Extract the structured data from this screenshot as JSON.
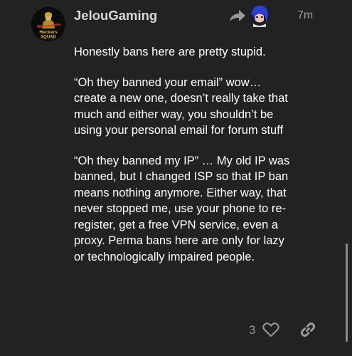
{
  "post": {
    "username": "JelouGaming",
    "date": "7m",
    "avatar_text": [
      "Heckers",
      "SQUAD"
    ],
    "paragraphs": [
      {
        "lines": [
          "Honestly bans here are pretty stupid."
        ]
      },
      {
        "lines": [
          "“Oh they banned your email” wow…",
          "create a new one, doesn’t really take that",
          "much and either way, you shouldn’t be",
          "using your personal email for forum stuff"
        ]
      },
      {
        "lines": [
          "“Oh they banned my IP” … My old IP was",
          "banned, but I changed ISP so that IP ban",
          "means nothing anymore. Either way, that",
          "never stopped me, use your phone to re-",
          "register, get a free VPN service, even a",
          "proxy. Perma bans here are only for lazy",
          "or technologically impaired people."
        ]
      }
    ],
    "like_count": "3"
  },
  "icons": {
    "reply": "reply-arrow-icon",
    "like": "heart-icon",
    "link": "link-icon"
  },
  "colors": {
    "background": "#222222",
    "text": "#ffffff",
    "muted": "#9a9a9a",
    "username": "#d8d8d8"
  }
}
